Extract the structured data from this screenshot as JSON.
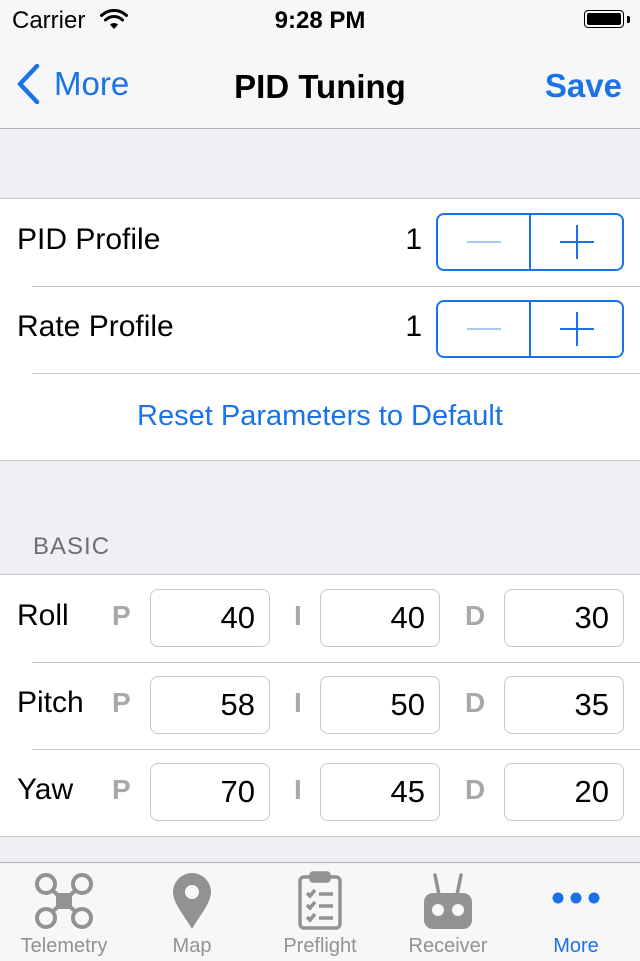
{
  "status_bar": {
    "carrier": "Carrier",
    "time": "9:28 PM",
    "icons": [
      "wifi-icon",
      "battery-icon"
    ]
  },
  "nav": {
    "back_label": "More",
    "title": "PID Tuning",
    "save_label": "Save"
  },
  "profiles": [
    {
      "label": "PID Profile",
      "value": "1"
    },
    {
      "label": "Rate Profile",
      "value": "1"
    }
  ],
  "reset_label": "Reset Parameters to Default",
  "basic": {
    "header": "BASIC",
    "term_labels": {
      "p": "P",
      "i": "I",
      "d": "D"
    },
    "rows": [
      {
        "axis": "Roll",
        "p": "40",
        "i": "40",
        "d": "30"
      },
      {
        "axis": "Pitch",
        "p": "58",
        "i": "50",
        "d": "35"
      },
      {
        "axis": "Yaw",
        "p": "70",
        "i": "45",
        "d": "20"
      }
    ]
  },
  "tabs": [
    {
      "label": "Telemetry",
      "icon": "quadcopter-icon",
      "active": false
    },
    {
      "label": "Map",
      "icon": "map-pin-icon",
      "active": false
    },
    {
      "label": "Preflight",
      "icon": "clipboard-checklist-icon",
      "active": false
    },
    {
      "label": "Receiver",
      "icon": "remote-control-icon",
      "active": false
    },
    {
      "label": "More",
      "icon": "more-dots-icon",
      "active": true
    }
  ],
  "colors": {
    "accent": "#1a73e8",
    "background": "#efeff4",
    "tab_inactive": "#929292",
    "term_letter": "#a7a7ac"
  }
}
